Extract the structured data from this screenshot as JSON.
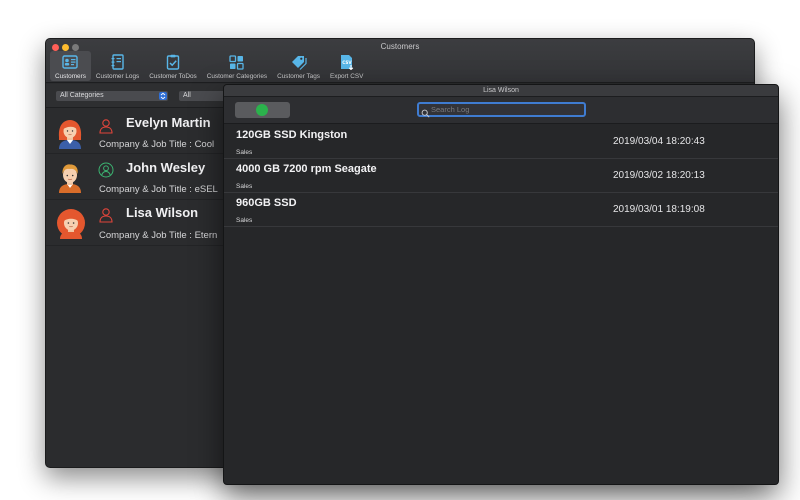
{
  "window": {
    "title": "Customers"
  },
  "toolbar": {
    "items": [
      {
        "label": "Customers",
        "icon": "contact-card-icon"
      },
      {
        "label": "Customer Logs",
        "icon": "notebook-icon"
      },
      {
        "label": "Customer ToDos",
        "icon": "clipboard-check-icon"
      },
      {
        "label": "Customer Categories",
        "icon": "grid-icon"
      },
      {
        "label": "Customer Tags",
        "icon": "tags-icon"
      },
      {
        "label": "Export CSV",
        "icon": "csv-file-icon"
      }
    ]
  },
  "filters": {
    "category": "All Categories",
    "second": "All"
  },
  "customers": [
    {
      "name": "Evelyn Martin",
      "company": "Company & Job Title : Cool"
    },
    {
      "name": "John Wesley",
      "company": "Company & Job Title : eSEL"
    },
    {
      "name": "Lisa Wilson",
      "company": "Company & Job Title : Etern"
    }
  ],
  "log_window": {
    "title": "Lisa Wilson",
    "search_placeholder": "Search Log",
    "entries": [
      {
        "item": "120GB SSD Kingston",
        "category": "Sales",
        "date": "2019/03/04 18:20:43"
      },
      {
        "item": "4000 GB 7200 rpm Seagate",
        "category": "Sales",
        "date": "2019/03/02 18:20:13"
      },
      {
        "item": "960GB SSD",
        "category": "Sales",
        "date": "2019/03/01 18:19:08"
      }
    ]
  },
  "colors": {
    "accent": "#3f7cd1",
    "add_green": "#2bb24c",
    "icon_blue": "#58b6e8",
    "person_red": "#e0453b",
    "person_green": "#3cb371"
  }
}
